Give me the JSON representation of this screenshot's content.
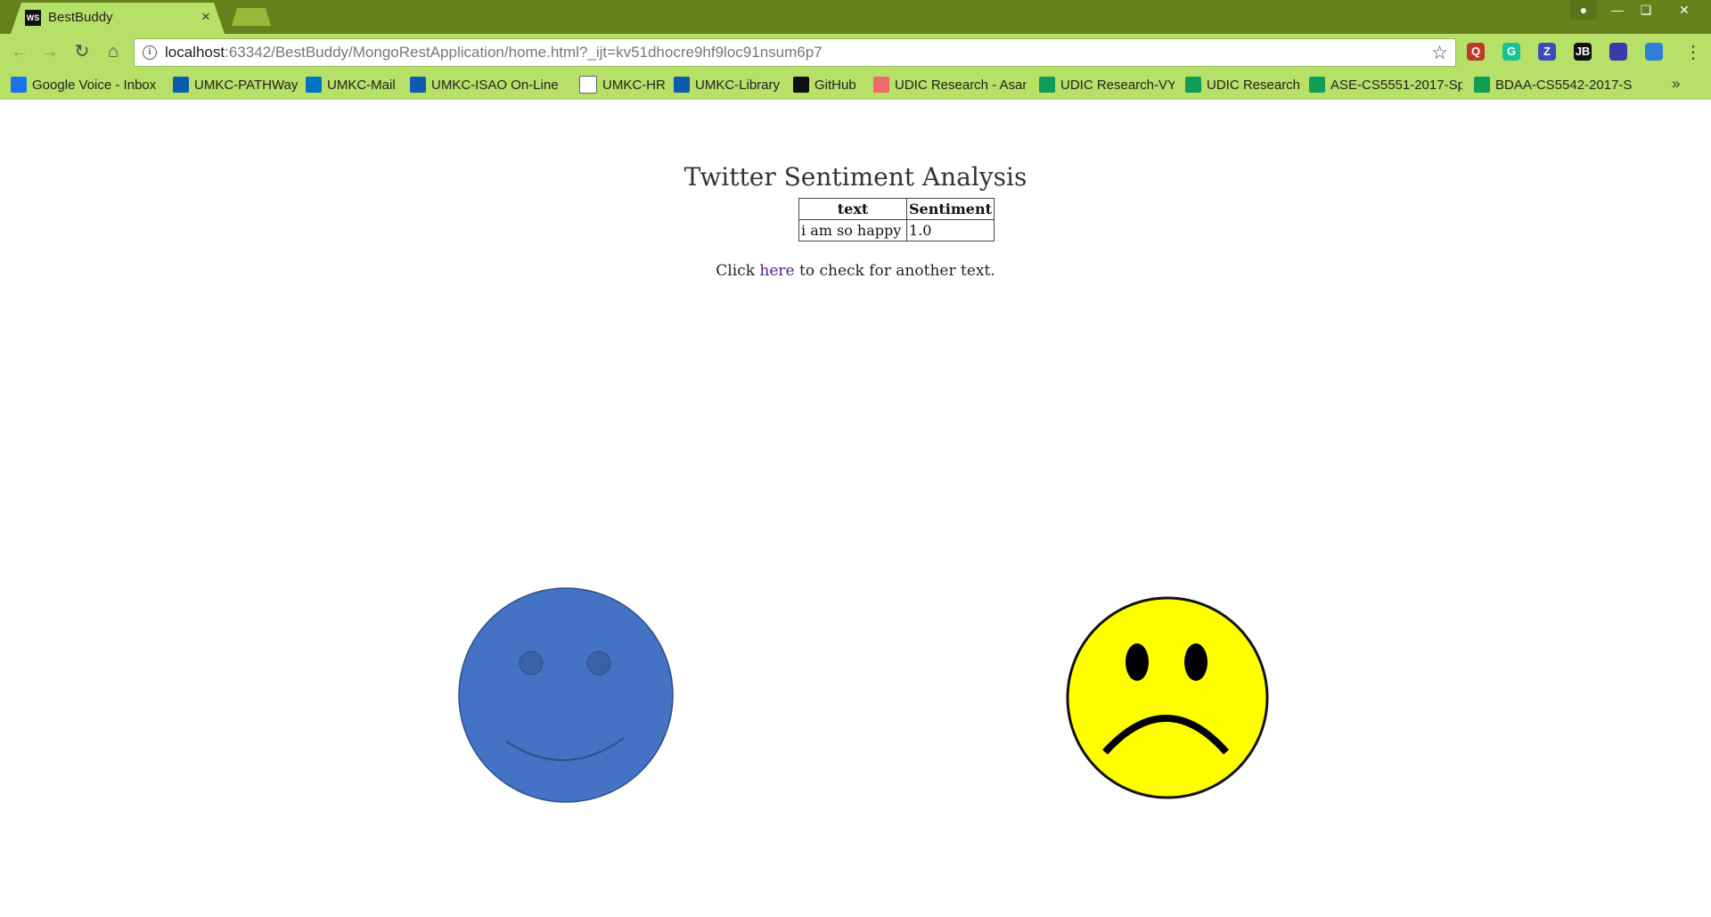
{
  "browser": {
    "tab_title": "BestBuddy",
    "tab_favicon": "WS",
    "tab_close": "×",
    "url_host": "localhost",
    "url_rest": ":63342/BestBuddy/MongoRestApplication/home.html?_ijt=kv51dhocre9hf9loc91nsum6p7",
    "extensions": [
      {
        "icon": "q-extension-icon",
        "label": "Q",
        "color": "#c0392b"
      },
      {
        "icon": "grammarly-icon",
        "label": "G",
        "color": "#15c39a"
      },
      {
        "icon": "z-extension-icon",
        "label": "Z",
        "color": "#3b4cb8"
      },
      {
        "icon": "jetbrains-icon",
        "label": "JB",
        "color": "#111111"
      },
      {
        "icon": "extension-icon",
        "label": "",
        "color": "#3a3aa8"
      },
      {
        "icon": "arrow-extension-icon",
        "label": "",
        "color": "#2f7fd8"
      }
    ]
  },
  "bookmarks": [
    {
      "label": "Google Voice - Inbox",
      "icon": "phone-icon",
      "color": "#1a73e8"
    },
    {
      "label": "UMKC-PATHWay",
      "icon": "umkc-icon",
      "color": "#0b5cad"
    },
    {
      "label": "UMKC-Mail",
      "icon": "outlook-icon",
      "color": "#0072c6"
    },
    {
      "label": "UMKC-ISAO On-Line",
      "icon": "umkc-icon",
      "color": "#0b5cad"
    },
    {
      "label": "UMKC-HR",
      "icon": "page-icon",
      "color": "#ffffff"
    },
    {
      "label": "UMKC-Library",
      "icon": "umkc-icon",
      "color": "#0b5cad"
    },
    {
      "label": "GitHub",
      "icon": "github-icon",
      "color": "#111111"
    },
    {
      "label": "UDIC Research - Asan",
      "icon": "asana-icon",
      "color": "#f06a6a"
    },
    {
      "label": "UDIC Research-VY",
      "icon": "sheets-icon",
      "color": "#0f9d58"
    },
    {
      "label": "UDIC Research",
      "icon": "sheets-icon",
      "color": "#0f9d58"
    },
    {
      "label": "ASE-CS5551-2017-Sp",
      "icon": "sheets-icon",
      "color": "#0f9d58"
    },
    {
      "label": "BDAA-CS5542-2017-S",
      "icon": "sheets-icon",
      "color": "#0f9d58"
    }
  ],
  "bookmarks_more": "»",
  "page": {
    "title": "Twitter Sentiment Analysis",
    "table": {
      "headers": [
        "text",
        "Sentiment"
      ],
      "rows": [
        [
          "i am so happy",
          "1.0"
        ]
      ]
    },
    "click_prefix": "Click ",
    "click_link": "here",
    "click_suffix": " to check for another text."
  },
  "faces": {
    "happy_color": "#4472c4",
    "sad_color": "#ffff00"
  }
}
